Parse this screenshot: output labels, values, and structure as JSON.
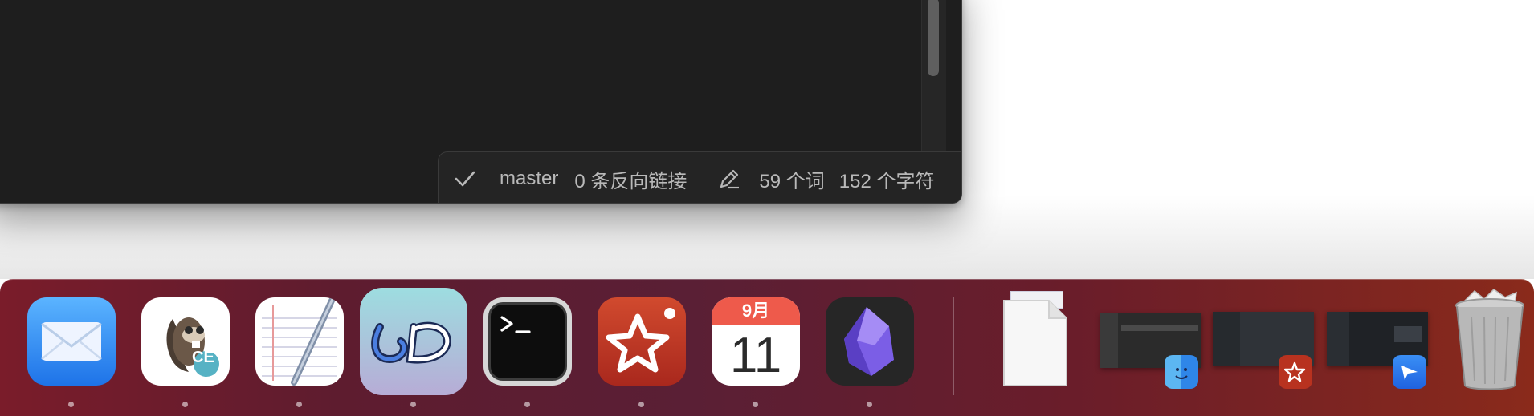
{
  "status_bar": {
    "sync_icon": "checkmark-icon",
    "branch": "master",
    "backlinks": "0 条反向链接",
    "edit_icon": "pencil-icon",
    "words": "59 个词",
    "chars": "152 个字符"
  },
  "calendar": {
    "month": "9月",
    "day": "11"
  },
  "dock": {
    "apps": [
      "Mail",
      "Beaver CE",
      "TextEdit",
      "LD",
      "Terminal",
      "Star app",
      "Calendar",
      "Obsidian"
    ],
    "running_indicators": [
      true,
      true,
      true,
      true,
      true,
      true,
      true,
      true
    ],
    "right_items": [
      "Document",
      "Finder window",
      "Star app window",
      "Feishu window",
      "Trash"
    ]
  },
  "colors": {
    "window_bg": "#1e1e1e",
    "status_text": "#b9b9b9",
    "dock_left": "#7a1c2a",
    "dock_right": "#8a2a1b"
  }
}
